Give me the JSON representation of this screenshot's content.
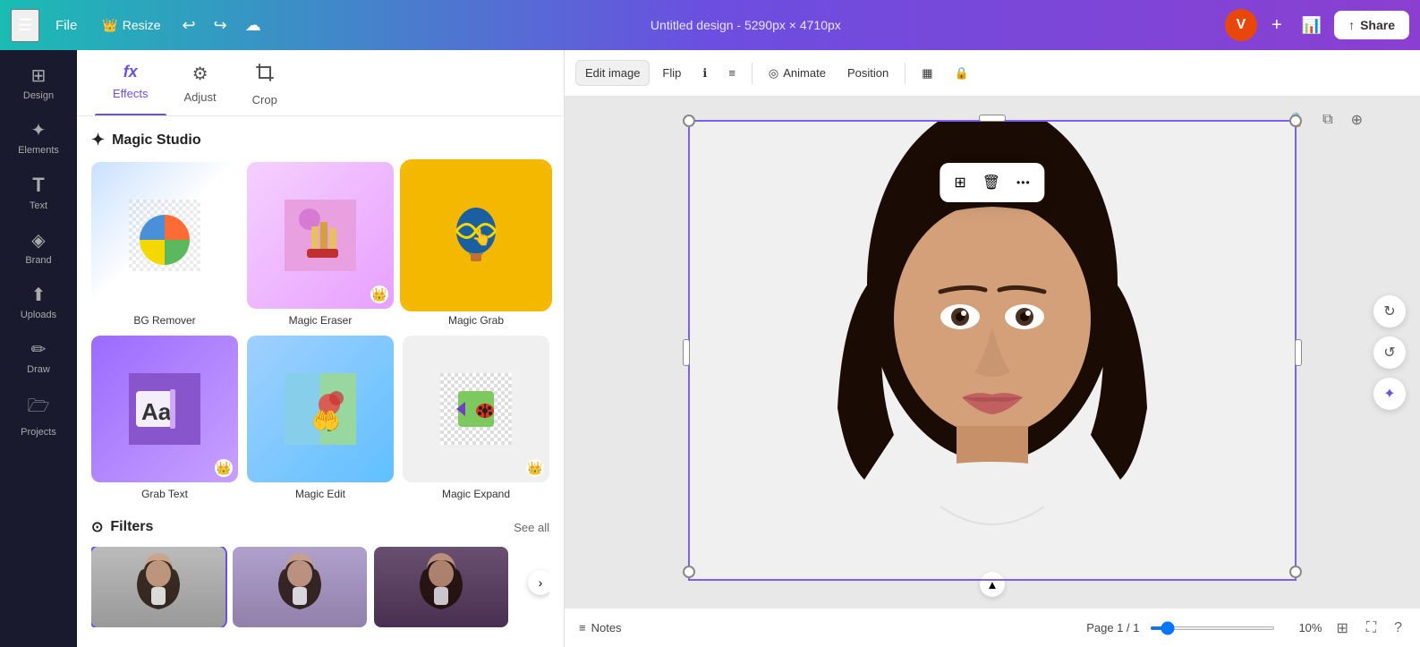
{
  "topbar": {
    "menu_icon": "☰",
    "file_label": "File",
    "resize_label": "Resize",
    "crown_icon": "👑",
    "undo_icon": "↩",
    "redo_icon": "↪",
    "cloud_icon": "☁",
    "title": "Untitled design - 5290px × 4710px",
    "avatar_letter": "V",
    "plus_icon": "+",
    "stats_icon": "📊",
    "share_upload_icon": "↑",
    "share_label": "Share"
  },
  "left_nav": {
    "items": [
      {
        "id": "design",
        "icon": "⊞",
        "label": "Design"
      },
      {
        "id": "elements",
        "icon": "✦",
        "label": "Elements"
      },
      {
        "id": "text",
        "icon": "T",
        "label": "Text"
      },
      {
        "id": "brand",
        "icon": "◈",
        "label": "Brand"
      },
      {
        "id": "uploads",
        "icon": "⬆",
        "label": "Uploads"
      },
      {
        "id": "draw",
        "icon": "✏",
        "label": "Draw"
      },
      {
        "id": "projects",
        "icon": "🗁",
        "label": "Projects"
      }
    ]
  },
  "side_panel": {
    "tabs": [
      {
        "id": "effects",
        "icon": "fx",
        "label": "Effects",
        "active": true
      },
      {
        "id": "adjust",
        "icon": "⚙",
        "label": "Adjust",
        "active": false
      },
      {
        "id": "crop",
        "icon": "⊡",
        "label": "Crop",
        "active": false
      }
    ],
    "magic_studio": {
      "title": "Magic Studio",
      "icon": "✦",
      "tools": [
        {
          "id": "bg-remover",
          "label": "BG Remover",
          "emoji": "🏐",
          "has_crown": false,
          "selected": false
        },
        {
          "id": "magic-eraser",
          "label": "Magic Eraser",
          "emoji": "🍟",
          "has_crown": true,
          "selected": false
        },
        {
          "id": "magic-grab",
          "label": "Magic Grab",
          "emoji": "🎈",
          "has_crown": false,
          "selected": true
        },
        {
          "id": "grab-text",
          "label": "Grab Text",
          "emoji": "Aa",
          "has_crown": true,
          "selected": false
        },
        {
          "id": "magic-edit",
          "label": "Magic Edit",
          "emoji": "🌹",
          "has_crown": false,
          "selected": false
        },
        {
          "id": "magic-expand",
          "label": "Magic Expand",
          "emoji": "🐞",
          "has_crown": true,
          "selected": false
        }
      ]
    },
    "filters": {
      "title": "Filters",
      "icon": "⊙",
      "see_all_label": "See all",
      "items": [
        {
          "id": "filter-1",
          "label": "",
          "active": true
        },
        {
          "id": "filter-2",
          "label": "",
          "active": false
        },
        {
          "id": "filter-3",
          "label": "",
          "active": false
        }
      ]
    }
  },
  "image_toolbar": {
    "edit_image_label": "Edit image",
    "flip_label": "Flip",
    "info_icon": "ℹ",
    "menu_icon": "≡",
    "animate_icon": "◎",
    "animate_label": "Animate",
    "position_label": "Position",
    "transparency_icon": "▦",
    "lock_icon": "🔒"
  },
  "canvas": {
    "corner_icons": [
      "🔒",
      "⧉",
      "⊕"
    ],
    "float_toolbar": {
      "copy_icon": "⊞",
      "trash_icon": "🗑",
      "more_icon": "•••"
    },
    "right_float": {
      "rotate_icon": "↻",
      "sync_icon": "↺"
    }
  },
  "bottom_bar": {
    "notes_icon": "≡",
    "notes_label": "Notes",
    "page_info": "Page 1 / 1",
    "zoom_level": "10%",
    "grid_icon": "⊞",
    "expand_icon": "⛶",
    "help_icon": "?"
  }
}
